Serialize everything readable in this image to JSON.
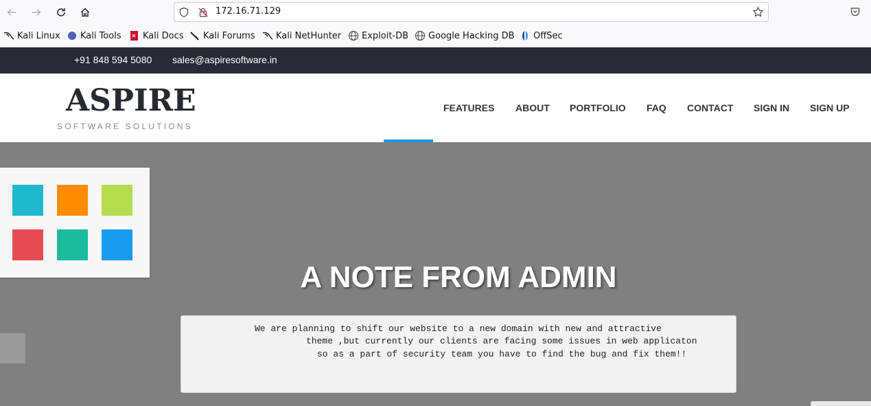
{
  "browser": {
    "url": "172.16.71.129",
    "icons": [
      "back-icon",
      "forward-icon",
      "reload-icon",
      "home-icon",
      "shield-icon",
      "insecure-lock-icon",
      "bookmark-star-icon",
      "pocket-icon"
    ]
  },
  "bookmarks": [
    {
      "label": "Kali Linux",
      "icon": "kali-dragon-icon"
    },
    {
      "label": "Kali Tools",
      "icon": "kali-tools-icon"
    },
    {
      "label": "Kali Docs",
      "icon": "kali-docs-icon"
    },
    {
      "label": "Kali Forums",
      "icon": "kali-forums-icon"
    },
    {
      "label": "Kali NetHunter",
      "icon": "kali-dragon-icon"
    },
    {
      "label": "Exploit-DB",
      "icon": "globe-icon"
    },
    {
      "label": "Google Hacking DB",
      "icon": "globe-icon"
    },
    {
      "label": "OffSec",
      "icon": "offsec-icon"
    }
  ],
  "topbar": {
    "phone": "+91 848 594 5080",
    "email": "sales@aspiresoftware.in"
  },
  "header": {
    "logo": "ASPIRE",
    "tagline": "SOFTWARE SOLUTIONS",
    "menu": [
      "FEATURES",
      "ABOUT",
      "PORTFOLIO",
      "FAQ",
      "CONTACT",
      "SIGN IN",
      "SIGN UP"
    ]
  },
  "theme_colors": [
    "#1eb9cc",
    "#ff8c00",
    "#b5dd4e",
    "#e84b52",
    "#1abc9c",
    "#1a9bf0"
  ],
  "accent_color": "#1e97e0",
  "hero": {
    "title": "A NOTE FROM ADMIN",
    "note_lines": [
      "We are planning to shift our website to a new domain with new and attractive",
      "theme ,but currently our clients are facing some issues in web applicaton",
      "so as a part of security team you have to find the bug and fix them!!"
    ]
  }
}
